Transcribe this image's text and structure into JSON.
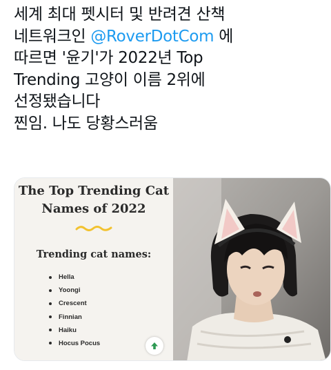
{
  "tweet": {
    "line1": "세계 최대 펫시터 및 반려견 산책",
    "line2_prefix": "네트워크인 ",
    "line2_mention": "@RoverDotCom",
    "line2_suffix": " 에",
    "line3": "따르면 '윤기'가 2022년 Top",
    "line4": "Trending 고양이 이름 2위에",
    "line5": "선정됐습니다",
    "line6": "찐임. 나도 당황스러움"
  },
  "card": {
    "title_line1": "The Top Trending Cat",
    "title_line2": "Names of 2022",
    "subtitle": "Trending cat names:",
    "names": [
      "Hella",
      "Yoongi",
      "Crescent",
      "Finnian",
      "Haiku",
      "Hocus Pocus"
    ],
    "accent_color": "#f2c230",
    "button_icon": "arrow-up-icon",
    "button_color": "#2e9a53"
  },
  "photo": {
    "subject": "person-with-cat-ear-headband"
  }
}
